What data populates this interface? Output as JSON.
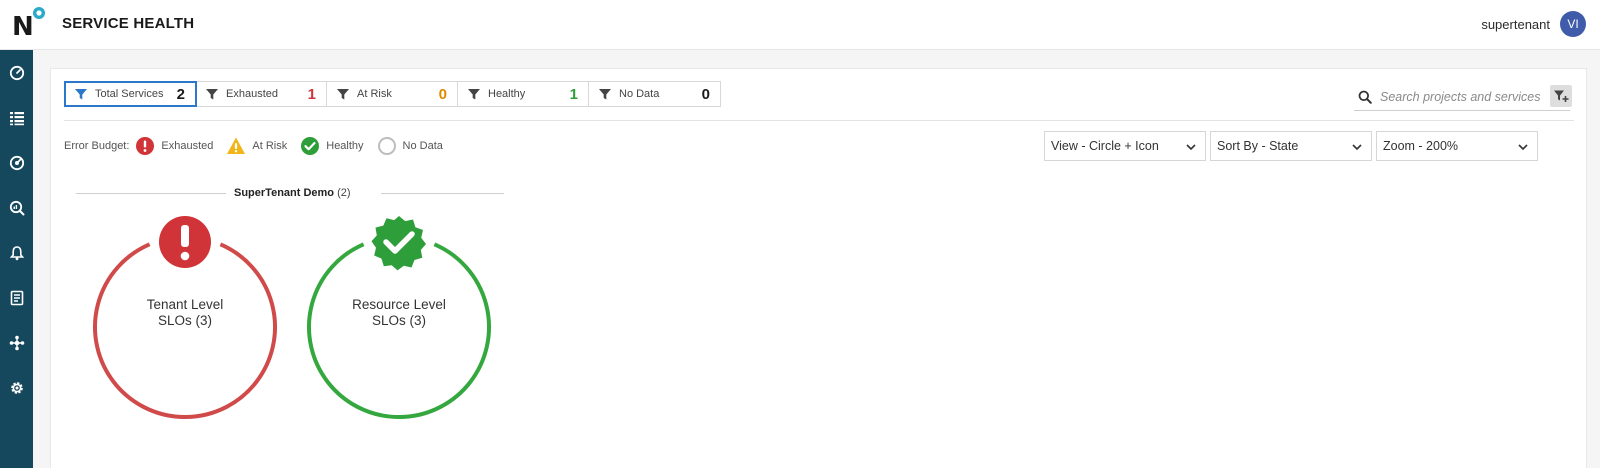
{
  "app": {
    "logo_letter": "N",
    "page_title": "SERVICE HEALTH",
    "user_name": "supertenant",
    "user_initials": "VI"
  },
  "sidebar": {
    "items": [
      {
        "icon": "dashboard-gauge-icon"
      },
      {
        "icon": "service-list-icon"
      },
      {
        "icon": "slo-target-icon"
      },
      {
        "icon": "analytics-search-icon"
      },
      {
        "icon": "alerts-bell-icon"
      },
      {
        "icon": "reports-document-icon"
      },
      {
        "icon": "integrations-icon"
      },
      {
        "icon": "settings-gear-icon"
      }
    ]
  },
  "filters": [
    {
      "label": "Total Services",
      "count": "2",
      "color": "#1a1a1a",
      "active": true
    },
    {
      "label": "Exhausted",
      "count": "1",
      "color": "#d13438"
    },
    {
      "label": "At Risk",
      "count": "0",
      "color": "#e08a00"
    },
    {
      "label": "Healthy",
      "count": "1",
      "color": "#2e9e3a"
    },
    {
      "label": "No Data",
      "count": "0",
      "color": "#1a1a1a"
    }
  ],
  "search": {
    "placeholder": "Search projects and services"
  },
  "legend": {
    "title": "Error Budget:",
    "items": [
      {
        "label": "Exhausted",
        "icon": "exclamation-circle-icon",
        "color": "#d13438"
      },
      {
        "label": "At Risk",
        "icon": "warning-triangle-icon",
        "color": "#f2b518"
      },
      {
        "label": "Healthy",
        "icon": "check-badge-icon",
        "color": "#2e9e3a"
      },
      {
        "label": "No Data",
        "icon": "empty-circle-icon",
        "color": "#bdbdbd"
      }
    ]
  },
  "dropdowns": {
    "view": "View - Circle + Icon",
    "sort": "Sort By - State",
    "zoom": "Zoom - 200%"
  },
  "group": {
    "title": "SuperTenant Demo",
    "count": "(2)"
  },
  "services": [
    {
      "line1": "Tenant Level",
      "line2": "SLOs (3)",
      "state": "Exhausted",
      "color": "#d04a4a"
    },
    {
      "line1": "Resource Level",
      "line2": "SLOs (3)",
      "state": "Healthy",
      "color": "#34a83f"
    }
  ]
}
